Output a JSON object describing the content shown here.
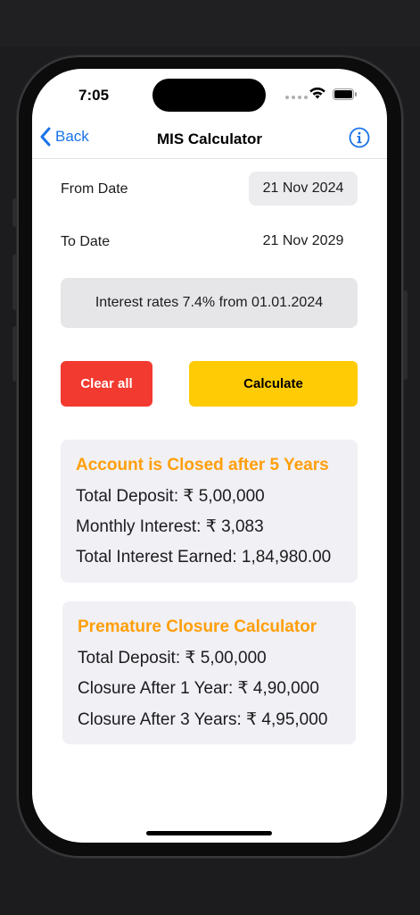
{
  "status_bar": {
    "time": "7:05"
  },
  "nav": {
    "back_label": "Back",
    "title": "MIS Calculator"
  },
  "form": {
    "from_label": "From Date",
    "from_value": "21 Nov 2024",
    "to_label": "To Date",
    "to_value": "21 Nov 2029",
    "rate_note": "Interest rates 7.4% from 01.01.2024"
  },
  "actions": {
    "clear_label": "Clear all",
    "calculate_label": "Calculate"
  },
  "result_card": {
    "title": "Account is Closed after 5 Years",
    "total_deposit": "Total Deposit: ₹ 5,00,000",
    "monthly_interest": "Monthly Interest: ₹ 3,083",
    "total_interest": "Total Interest Earned: 1,84,980.00"
  },
  "premature_card": {
    "title": "Premature Closure Calculator",
    "total_deposit": "Total Deposit: ₹ 5,00,000",
    "after_1_year": "Closure After 1 Year: ₹ 4,90,000",
    "after_3_years": "Closure After 3 Years: ₹ 4,95,000"
  },
  "colors": {
    "accent_blue": "#1a73e8",
    "clear_red": "#f23a30",
    "calculate_yellow": "#ffcb05",
    "title_orange": "#ff9f0a",
    "card_bg": "#f0f0f5"
  },
  "icons": {
    "back": "chevron-left-icon",
    "info": "info-circle-icon",
    "wifi": "wifi-icon",
    "battery": "battery-icon"
  }
}
